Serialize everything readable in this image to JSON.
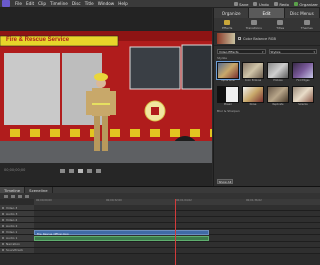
{
  "menubar": {
    "items": [
      "File",
      "Edit",
      "Clip",
      "Timeline",
      "Disc",
      "Title",
      "Window",
      "Help"
    ],
    "actions": [
      {
        "label": "Save",
        "icon": "save-icon"
      },
      {
        "label": "Undo",
        "icon": "undo-icon"
      },
      {
        "label": "Redo",
        "icon": "redo-icon"
      },
      {
        "label": "Organizer",
        "icon": "organizer-icon"
      }
    ]
  },
  "preview": {
    "sign_text": "Fire & Rescue Service",
    "timecode": "00;00;00;00"
  },
  "right_panel": {
    "tabs": [
      "Organize",
      "Edit",
      "Disc Menus"
    ],
    "active_tab": "Edit",
    "sub_tabs": [
      "Effects",
      "Transitions",
      "Titles",
      "Themes"
    ],
    "color_item": "Color Balance RGB",
    "dropdowns": [
      "Video Effects",
      "Stylize"
    ],
    "group_label": "Stylize",
    "effects": [
      "Alpha Glow",
      "Color Emboss",
      "Emboss",
      "Find Edges",
      "Mosaic",
      "Noise",
      "Replicate",
      "Solarize"
    ],
    "group2_label": "Blur & Sharpen",
    "apply_label": "Show All"
  },
  "timeline": {
    "tabs": [
      "Timeline",
      "Sceneline"
    ],
    "ruler_labels": [
      "00;00;00;00",
      "00;00;32;00",
      "00;01;04;02",
      "00;01;36;02"
    ],
    "tracks": [
      "Video 3",
      "Audio 3",
      "Video 2",
      "Audio 2",
      "Video 1",
      "Audio 1",
      "Narration",
      "Soundtrack"
    ],
    "clip_name": "Fire_Rescue_Officer.mpg"
  }
}
